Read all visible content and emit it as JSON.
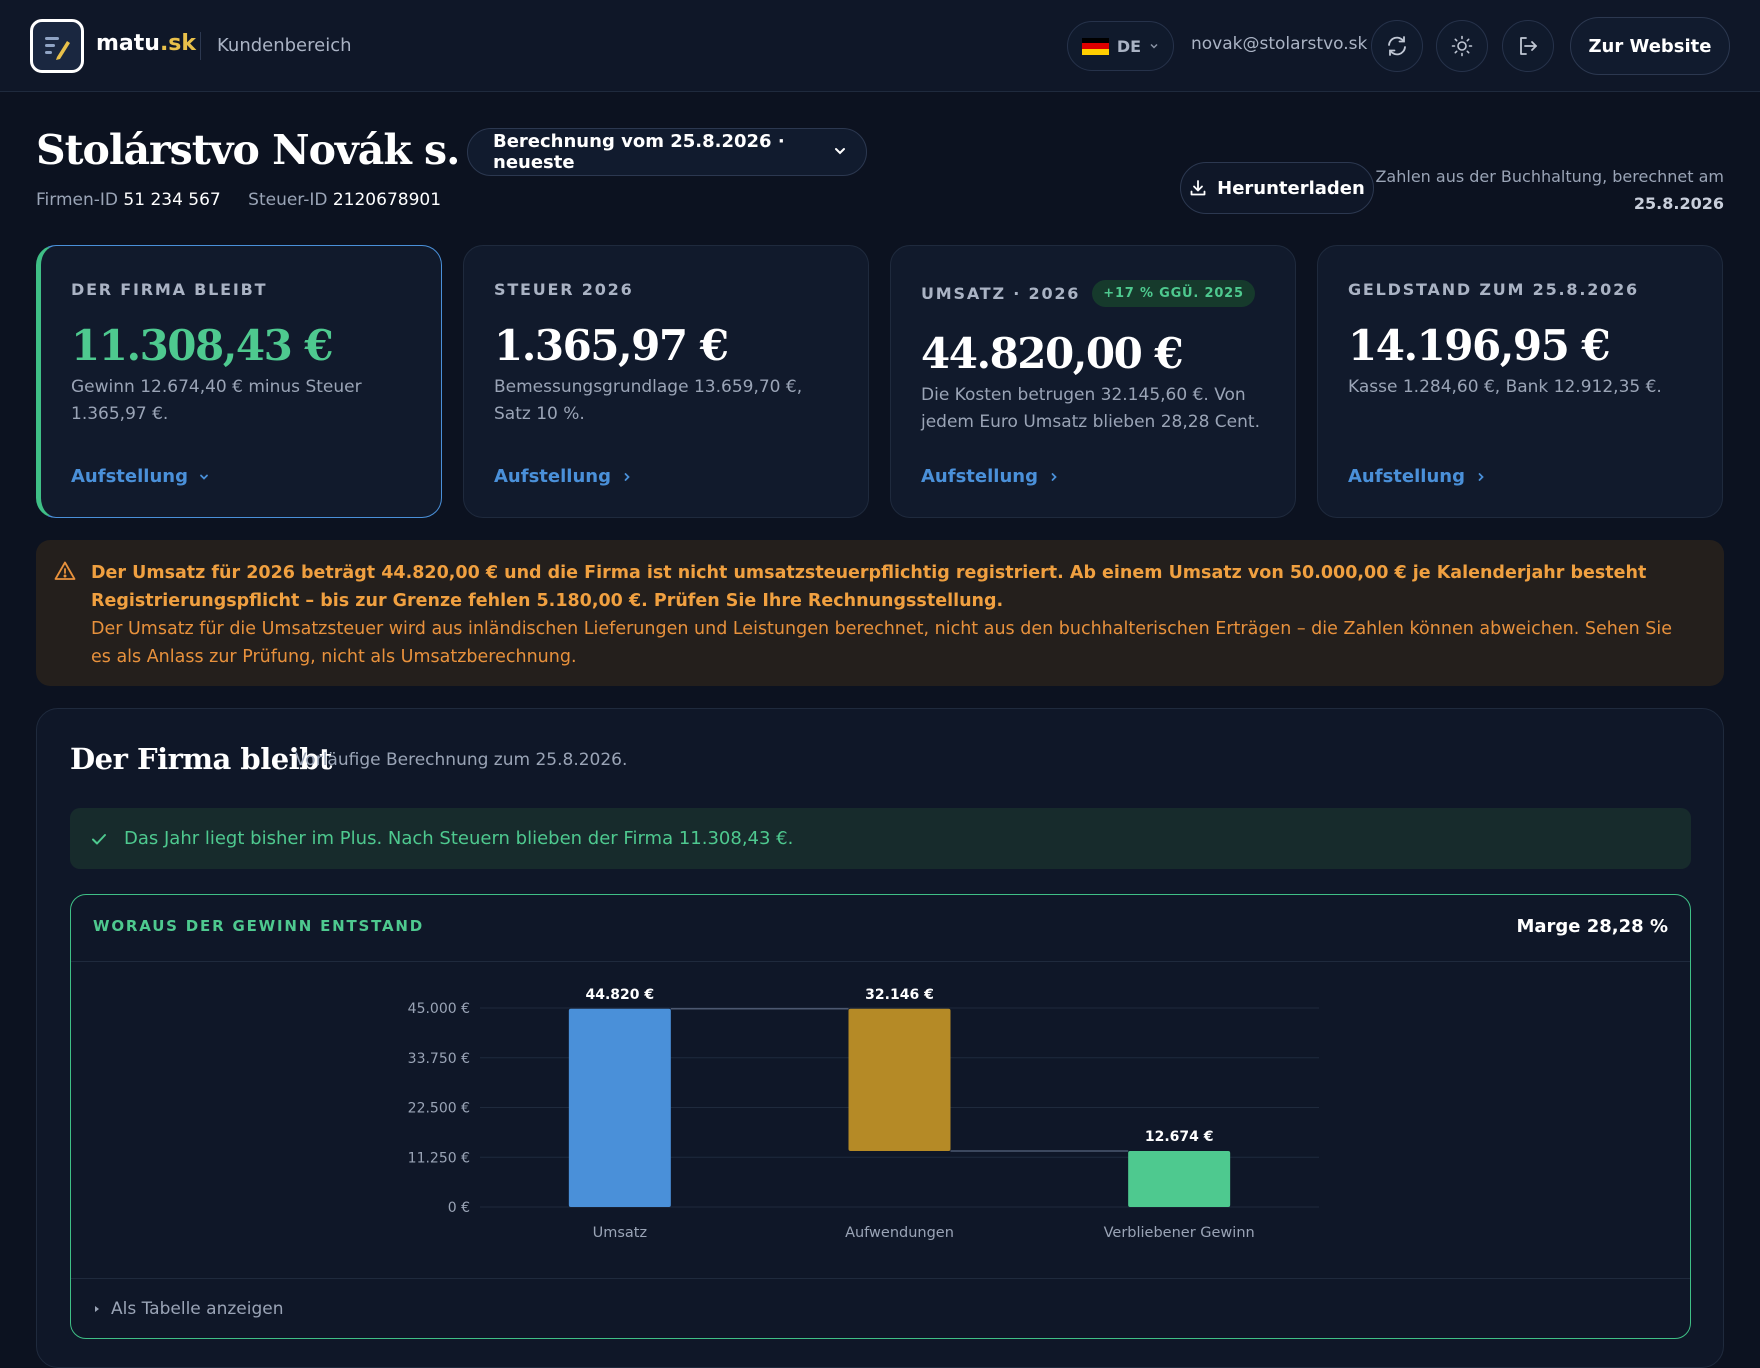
{
  "header": {
    "brand_name": "matu",
    "brand_tld": ".sk",
    "area": "Kundenbereich",
    "lang": "DE",
    "email": "novak@stolarstvo.sk",
    "website_button": "Zur Website"
  },
  "company": {
    "name": "Stolárstvo Novák s. r. o.",
    "firm_id_label": "Firmen-ID",
    "firm_id": "51 234 567",
    "tax_id_label": "Steuer-ID",
    "tax_id": "2120678901",
    "calc_select": "Berechnung vom 25.8.2026 · neueste",
    "download": "Herunterladen",
    "calc_note": "Zahlen aus der Buchhaltung, berechnet am",
    "calc_date": "25.8.2026"
  },
  "cards": [
    {
      "label": "DER FIRMA BLEIBT",
      "value": "11.308,43 €",
      "desc": "Gewinn 12.674,40 € minus Steuer 1.365,97 €.",
      "link": "Aufstellung"
    },
    {
      "label": "STEUER 2026",
      "value": "1.365,97 €",
      "desc": "Bemessungsgrundlage 13.659,70 €, Satz 10 %.",
      "link": "Aufstellung"
    },
    {
      "label": "UMSATZ · 2026",
      "badge": "+17 % GGÜ. 2025",
      "value": "44.820,00 €",
      "desc": "Die Kosten betrugen 32.145,60 €. Von jedem Euro Umsatz blieben 28,28 Cent.",
      "link": "Aufstellung"
    },
    {
      "label": "GELDSTAND ZUM 25.8.2026",
      "value": "14.196,95 €",
      "desc": "Kasse 1.284,60 €, Bank 12.912,35 €.",
      "link": "Aufstellung"
    }
  ],
  "warning": {
    "bold": "Der Umsatz für 2026 beträgt 44.820,00 € und die Firma ist nicht umsatzsteuerpflichtig registriert. Ab einem Umsatz von 50.000,00 € je Kalenderjahr besteht Registrierungspflicht – bis zur Grenze fehlen 5.180,00 €. Prüfen Sie Ihre Rechnungsstellung.",
    "text": "Der Umsatz für die Umsatzsteuer wird aus inländischen Lieferungen und Leistungen berechnet, nicht aus den buchhalterischen Erträgen – die Zahlen können abweichen. Sehen Sie es als Anlass zur Prüfung, nicht als Umsatzberechnung."
  },
  "panel": {
    "title": "Der Firma bleibt",
    "subtitle": "Vorläufige Berechnung zum 25.8.2026.",
    "ok_message": "Das Jahr liegt bisher im Plus. Nach Steuern blieben der Firma 11.308,43 €.",
    "chart_title": "WORAUS DER GEWINN ENTSTAND",
    "margin": "Marge 28,28 %",
    "table_toggle": "Als Tabelle anzeigen"
  },
  "colors": {
    "accent": "#4a90d9",
    "green": "#4ec98f",
    "warning": "#e8913c",
    "bar_revenue": "#4a90d9",
    "bar_expenses": "#b58a26",
    "bar_profit": "#4ec98f"
  },
  "icons": [
    "logo-icon",
    "refresh-icon",
    "sun-icon",
    "logout-icon",
    "download-icon",
    "chevron-down-icon",
    "chevron-right-icon",
    "warning-icon",
    "check-icon",
    "triangle-right-icon"
  ],
  "chart_data": {
    "type": "bar",
    "subtype": "waterfall",
    "categories": [
      "Umsatz",
      "Aufwendungen",
      "Verbliebener Gewinn"
    ],
    "bars": [
      {
        "label": "Umsatz",
        "base": 0,
        "top": 44820,
        "value_label": "44.820 €",
        "color": "#4a90d9"
      },
      {
        "label": "Aufwendungen",
        "base": 12674,
        "top": 44820,
        "value_label": "32.146 €",
        "color": "#b58a26"
      },
      {
        "label": "Verbliebener Gewinn",
        "base": 0,
        "top": 12674,
        "value_label": "12.674 €",
        "color": "#4ec98f"
      }
    ],
    "yticks": [
      0,
      11250,
      22500,
      33750,
      45000
    ],
    "ytick_labels": [
      "0 €",
      "11.250 €",
      "22.500 €",
      "33.750 €",
      "45.000 €"
    ],
    "ylim": [
      0,
      45000
    ],
    "grid": true
  }
}
